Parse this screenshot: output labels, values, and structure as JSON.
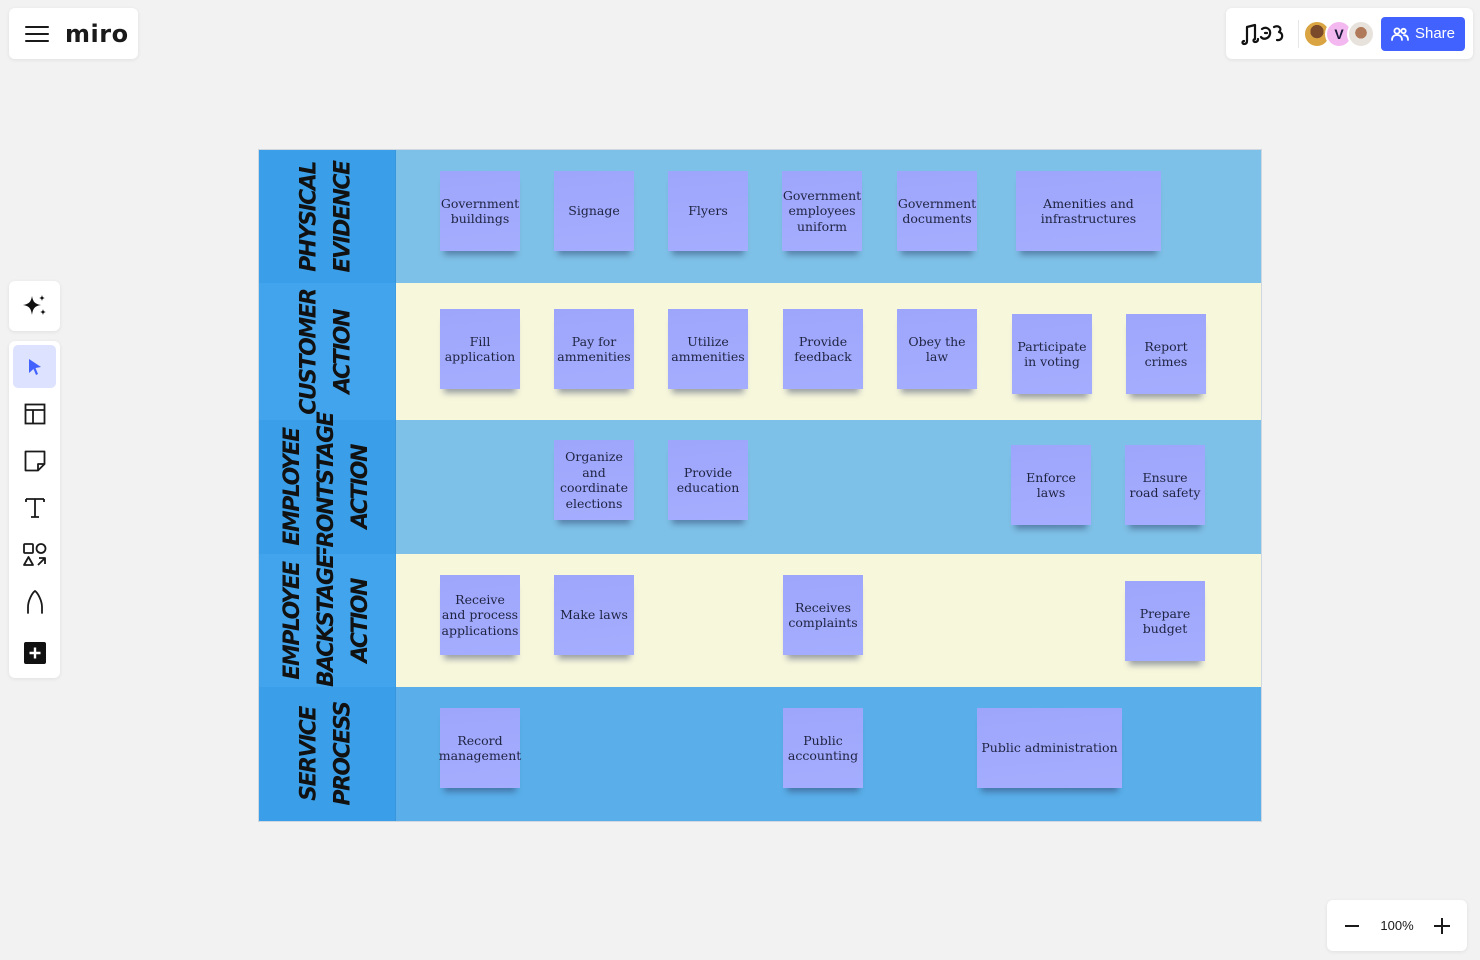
{
  "app": {
    "logo_text": "miro",
    "share_label": "Share",
    "zoom_level": "100%",
    "collaborators": [
      {
        "initial": "",
        "type": "photo"
      },
      {
        "initial": "V",
        "type": "initial",
        "color": "#f4b8f0"
      },
      {
        "initial": "",
        "type": "photo"
      }
    ],
    "accent_color": "#4262ff"
  },
  "toolbar": {
    "tools": [
      "select",
      "frames",
      "sticky-note",
      "text",
      "shapes",
      "pen",
      "more"
    ]
  },
  "board": {
    "lanes": [
      {
        "id": "physical-evidence",
        "title_lines": [
          "PHYSICAL",
          "EVIDENCE"
        ],
        "header_color": "#3a9fe8",
        "body_color": "#7ec1e8",
        "notes": [
          {
            "text": "Government buildings"
          },
          {
            "text": "Signage"
          },
          {
            "text": "Flyers"
          },
          {
            "text": "Government employees uniform"
          },
          {
            "text": "Government documents"
          },
          {
            "text": "Amenities and infrastructures"
          }
        ]
      },
      {
        "id": "customer-action",
        "title_lines": [
          "CUSTOMER",
          "ACTION"
        ],
        "header_color": "#42a4ec",
        "body_color": "#f7f7dc",
        "notes": [
          {
            "text": "Fill application"
          },
          {
            "text": "Pay for ammenities"
          },
          {
            "text": "Utilize ammenities"
          },
          {
            "text": "Provide feedback"
          },
          {
            "text": "Obey the law"
          },
          {
            "text": "Participate in voting"
          },
          {
            "text": "Report crimes"
          }
        ]
      },
      {
        "id": "employee-frontstage-action",
        "title_lines": [
          "EMPLOYEE",
          "FRONTSTAGE",
          "ACTION"
        ],
        "header_color": "#3a9fe8",
        "body_color": "#7ec1e8",
        "notes": [
          {
            "text": "Organize and coordinate elections"
          },
          {
            "text": "Provide education"
          },
          {
            "text": "Enforce laws"
          },
          {
            "text": "Ensure road safety"
          }
        ]
      },
      {
        "id": "employee-backstage-action",
        "title_lines": [
          "EMPLOYEE",
          "BACKSTAGE",
          "ACTION"
        ],
        "header_color": "#42a4ec",
        "body_color": "#f7f7dc",
        "notes": [
          {
            "text": "Receive and process applications"
          },
          {
            "text": "Make laws"
          },
          {
            "text": "Receives complaints"
          },
          {
            "text": "Prepare budget"
          }
        ]
      },
      {
        "id": "service-process",
        "title_lines": [
          "SERVICE",
          "PROCESS"
        ],
        "header_color": "#3a9fe8",
        "body_color": "#5aafea",
        "notes": [
          {
            "text": "Record management"
          },
          {
            "text": "Public accounting"
          },
          {
            "text": "Public administration"
          }
        ]
      }
    ]
  }
}
